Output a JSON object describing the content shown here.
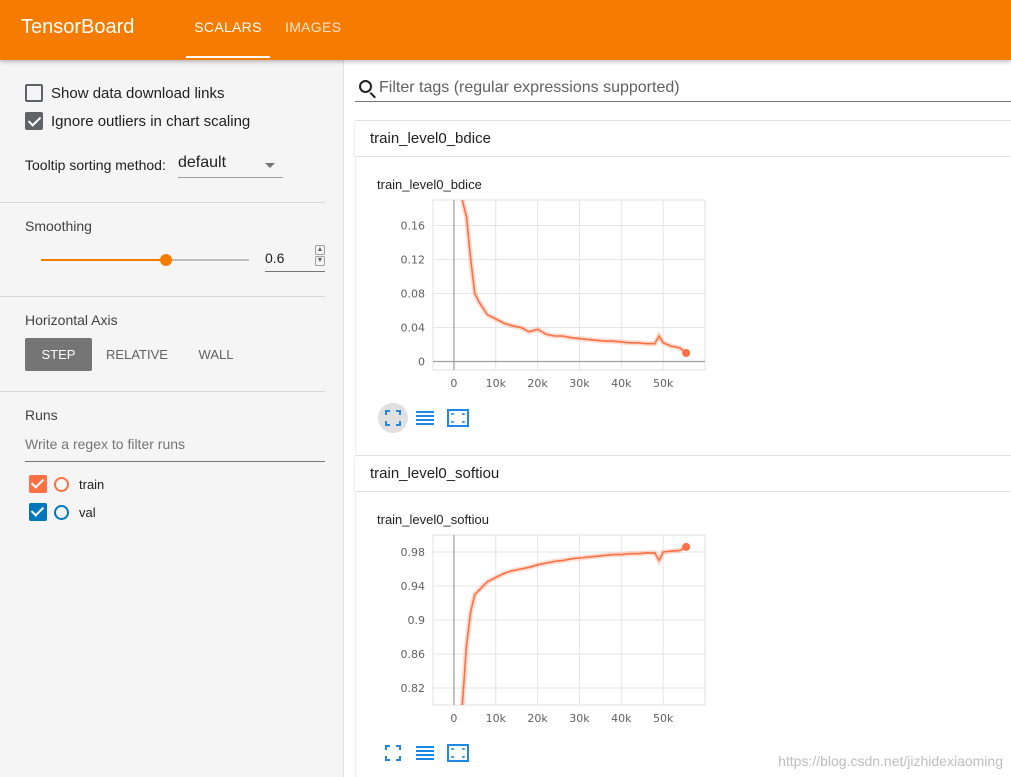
{
  "app": {
    "title": "TensorBoard"
  },
  "tabs": [
    {
      "label": "SCALARS"
    },
    {
      "label": "IMAGES"
    }
  ],
  "sidebar": {
    "show_download_links": {
      "label": "Show data download links",
      "checked": false
    },
    "ignore_outliers": {
      "label": "Ignore outliers in chart scaling",
      "checked": true
    },
    "tooltip_sorting": {
      "label": "Tooltip sorting method:",
      "value": "default"
    },
    "smoothing": {
      "title": "Smoothing",
      "value": "0.6",
      "fraction": 0.6
    },
    "horizontal_axis": {
      "title": "Horizontal Axis",
      "options": [
        "STEP",
        "RELATIVE",
        "WALL"
      ],
      "selected": "STEP"
    },
    "runs": {
      "title": "Runs",
      "filter_placeholder": "Write a regex to filter runs",
      "items": [
        {
          "name": "train",
          "color": "#ff7043",
          "checked": true
        },
        {
          "name": "val",
          "color": "#0077bb",
          "checked": true
        }
      ]
    }
  },
  "main": {
    "tag_filter_placeholder": "Filter tags (regular expressions supported)",
    "categories": [
      {
        "name": "train_level0_bdice",
        "card_title": "train_level0_bdice"
      },
      {
        "name": "train_level0_softiou",
        "card_title": "train_level0_softiou"
      }
    ]
  },
  "colors": {
    "accent": "#f57c00",
    "series": "#ff7043",
    "toolbar_icon": "#1e88e5"
  },
  "watermark": "https://blog.csdn.net/jizhidexiaoming",
  "chart_data": [
    {
      "type": "line",
      "title": "train_level0_bdice",
      "xlim": [
        -5000,
        60000
      ],
      "ylim": [
        -0.01,
        0.19
      ],
      "x_ticks": [
        0,
        10000,
        20000,
        30000,
        40000,
        50000
      ],
      "x_tick_labels": [
        "0",
        "10k",
        "20k",
        "30k",
        "40k",
        "50k"
      ],
      "y_ticks": [
        0,
        0.04,
        0.08,
        0.12,
        0.16
      ],
      "y_tick_labels": [
        "0",
        "0.04",
        "0.08",
        "0.12",
        "0.16"
      ],
      "grid": true,
      "series": [
        {
          "color": "#ff7043",
          "x": [
            2000,
            3000,
            4000,
            5000,
            6000,
            8000,
            10000,
            12000,
            14000,
            16000,
            18000,
            20000,
            22000,
            24000,
            26000,
            28000,
            30000,
            32000,
            34000,
            36000,
            38000,
            40000,
            42000,
            44000,
            46000,
            48000,
            49000,
            50000,
            52000,
            54000,
            55500
          ],
          "y": [
            0.19,
            0.17,
            0.12,
            0.08,
            0.07,
            0.055,
            0.05,
            0.045,
            0.042,
            0.04,
            0.035,
            0.038,
            0.032,
            0.03,
            0.03,
            0.028,
            0.027,
            0.026,
            0.025,
            0.024,
            0.024,
            0.023,
            0.022,
            0.022,
            0.021,
            0.021,
            0.03,
            0.022,
            0.018,
            0.016,
            0.01
          ]
        }
      ]
    },
    {
      "type": "line",
      "title": "train_level0_softiou",
      "xlim": [
        -5000,
        60000
      ],
      "ylim": [
        0.8,
        1.0
      ],
      "x_ticks": [
        0,
        10000,
        20000,
        30000,
        40000,
        50000
      ],
      "x_tick_labels": [
        "0",
        "10k",
        "20k",
        "30k",
        "40k",
        "50k"
      ],
      "y_ticks": [
        0.82,
        0.86,
        0.9,
        0.94,
        0.98
      ],
      "y_tick_labels": [
        "0.82",
        "0.86",
        "0.9",
        "0.94",
        "0.98"
      ],
      "grid": true,
      "series": [
        {
          "color": "#ff7043",
          "x": [
            2000,
            3000,
            4000,
            5000,
            6000,
            8000,
            10000,
            12000,
            14000,
            16000,
            18000,
            20000,
            22000,
            24000,
            26000,
            28000,
            30000,
            32000,
            34000,
            36000,
            38000,
            40000,
            42000,
            44000,
            46000,
            48000,
            49000,
            50000,
            52000,
            54000,
            55500
          ],
          "y": [
            0.8,
            0.87,
            0.91,
            0.93,
            0.935,
            0.945,
            0.95,
            0.955,
            0.958,
            0.96,
            0.962,
            0.965,
            0.967,
            0.969,
            0.97,
            0.972,
            0.973,
            0.974,
            0.975,
            0.976,
            0.977,
            0.977,
            0.978,
            0.978,
            0.979,
            0.979,
            0.97,
            0.98,
            0.981,
            0.982,
            0.986
          ]
        }
      ]
    }
  ]
}
